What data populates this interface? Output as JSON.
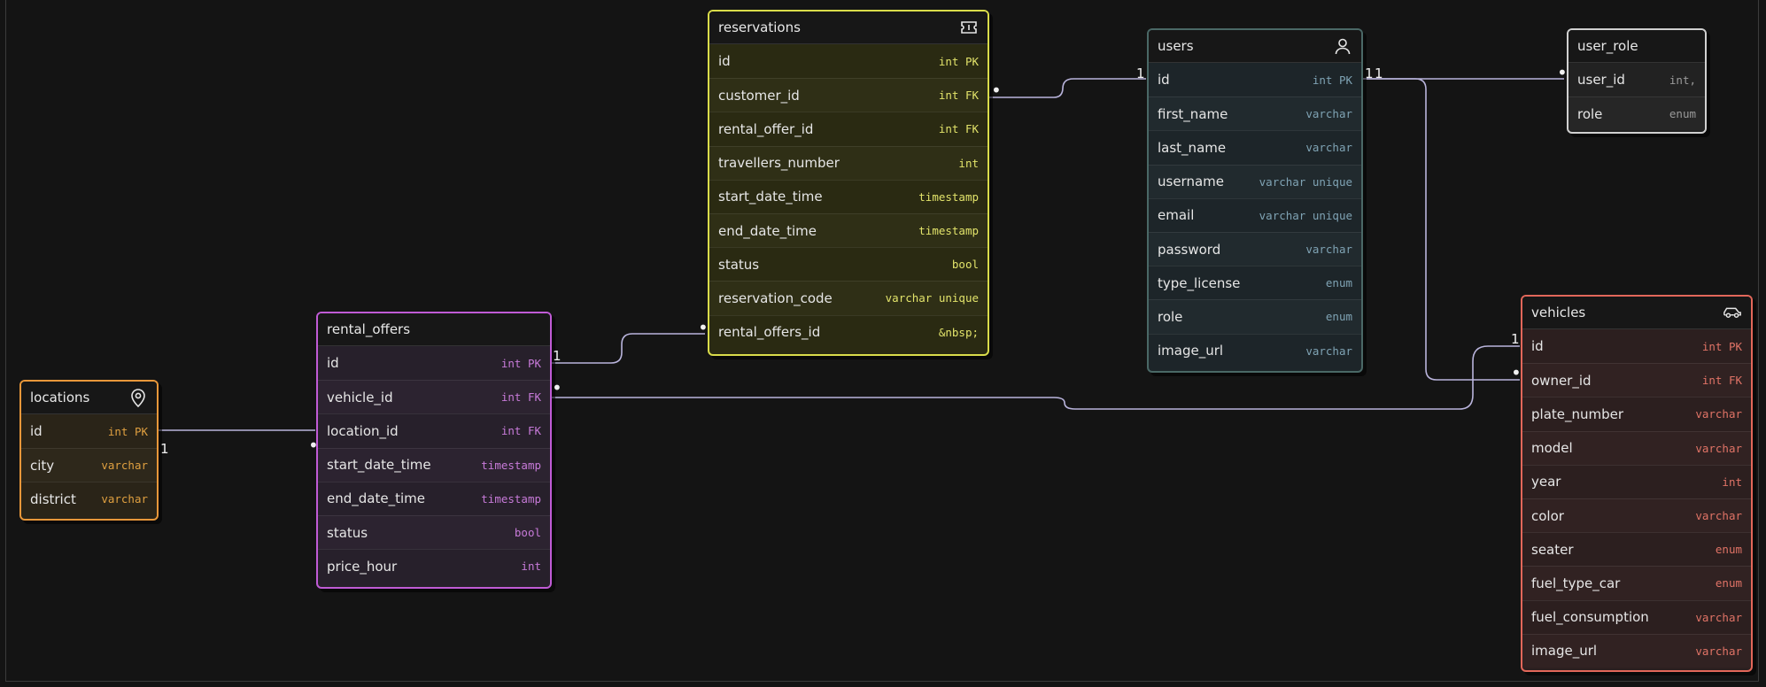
{
  "colors": {
    "background": "#141414",
    "edge": "#b9b4dc",
    "reservations": "#d9dc4a",
    "users": "#4a6866",
    "user_role": "#d0d0d0",
    "rental_offers": "#c05bd6",
    "locations": "#e8973a",
    "vehicles": "#e2675a"
  },
  "tables": {
    "reservations": {
      "name": "reservations",
      "icon": "ticket-icon",
      "columns": [
        {
          "name": "id",
          "type": "int PK"
        },
        {
          "name": "customer_id",
          "type": "int FK"
        },
        {
          "name": "rental_offer_id",
          "type": "int FK"
        },
        {
          "name": "travellers_number",
          "type": "int"
        },
        {
          "name": "start_date_time",
          "type": "timestamp"
        },
        {
          "name": "end_date_time",
          "type": "timestamp"
        },
        {
          "name": "status",
          "type": "bool"
        },
        {
          "name": "reservation_code",
          "type": "varchar unique"
        },
        {
          "name": "rental_offers_id",
          "type": "&nbsp;"
        }
      ]
    },
    "users": {
      "name": "users",
      "icon": "user-icon",
      "columns": [
        {
          "name": "id",
          "type": "int PK"
        },
        {
          "name": "first_name",
          "type": "varchar"
        },
        {
          "name": "last_name",
          "type": "varchar"
        },
        {
          "name": "username",
          "type": "varchar unique"
        },
        {
          "name": "email",
          "type": "varchar unique"
        },
        {
          "name": "password",
          "type": "varchar"
        },
        {
          "name": "type_license",
          "type": "enum"
        },
        {
          "name": "role",
          "type": "enum"
        },
        {
          "name": "image_url",
          "type": "varchar"
        }
      ]
    },
    "user_role": {
      "name": "user_role",
      "icon": "",
      "columns": [
        {
          "name": "user_id",
          "type": "int,"
        },
        {
          "name": "role",
          "type": "enum"
        }
      ]
    },
    "rental_offers": {
      "name": "rental_offers",
      "icon": "",
      "columns": [
        {
          "name": "id",
          "type": "int PK"
        },
        {
          "name": "vehicle_id",
          "type": "int FK"
        },
        {
          "name": "location_id",
          "type": "int FK"
        },
        {
          "name": "start_date_time",
          "type": "timestamp"
        },
        {
          "name": "end_date_time",
          "type": "timestamp"
        },
        {
          "name": "status",
          "type": "bool"
        },
        {
          "name": "price_hour",
          "type": "int"
        }
      ]
    },
    "locations": {
      "name": "locations",
      "icon": "map-pin-icon",
      "columns": [
        {
          "name": "id",
          "type": "int PK"
        },
        {
          "name": "city",
          "type": "varchar"
        },
        {
          "name": "district",
          "type": "varchar"
        }
      ]
    },
    "vehicles": {
      "name": "vehicles",
      "icon": "car-icon",
      "columns": [
        {
          "name": "id",
          "type": "int PK"
        },
        {
          "name": "owner_id",
          "type": "int FK"
        },
        {
          "name": "plate_number",
          "type": "varchar"
        },
        {
          "name": "model",
          "type": "varchar"
        },
        {
          "name": "year",
          "type": "int"
        },
        {
          "name": "color",
          "type": "varchar"
        },
        {
          "name": "seater",
          "type": "enum"
        },
        {
          "name": "fuel_type_car",
          "type": "enum"
        },
        {
          "name": "fuel_consumption",
          "type": "varchar"
        },
        {
          "name": "image_url",
          "type": "varchar"
        }
      ]
    }
  },
  "relations": [
    {
      "from": "users.id",
      "from_card": "1",
      "to": "reservations.customer_id",
      "to_card": "•"
    },
    {
      "from": "rental_offers.id",
      "from_card": "1",
      "to": "reservations.rental_offers_id",
      "to_card": "•"
    },
    {
      "from": "users.id",
      "from_card": "1",
      "to": "user_role.user_id",
      "to_card": "•"
    },
    {
      "from": "users.id",
      "from_card": "1",
      "to": "vehicles.owner_id",
      "to_card": "•"
    },
    {
      "from": "vehicles.id",
      "from_card": "1",
      "to": "rental_offers.vehicle_id",
      "to_card": "•"
    },
    {
      "from": "locations.id",
      "from_card": "1",
      "to": "rental_offers.location_id",
      "to_card": "•"
    }
  ]
}
